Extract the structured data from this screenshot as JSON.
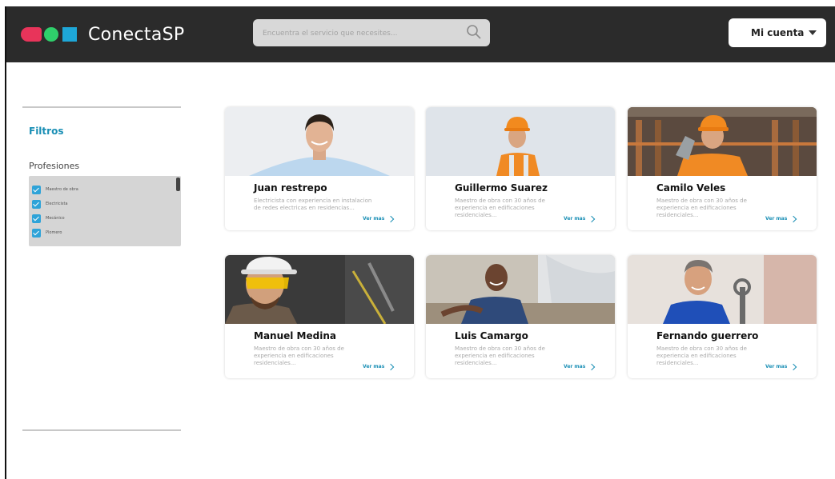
{
  "header": {
    "brand": "ConectaSP",
    "search_placeholder": "Encuentra el servicio que necesites...",
    "account_label": "Mi cuenta"
  },
  "colors": {
    "topbar": "#2b2b2b",
    "accent": "#1a8fb5",
    "logo_red": "#e8345a",
    "logo_green": "#2fd06b",
    "logo_blue": "#1ea7d8"
  },
  "sidebar": {
    "filters_title": "Filtros",
    "professions_title": "Profesiones",
    "professions": [
      "Maestro de obra",
      "Electricista",
      "Mecánico",
      "Plomero"
    ]
  },
  "cards": [
    {
      "name": "Juan restrepo",
      "description": "Electricista con experiencia en instalacion de redes electricas en residencias...",
      "link": "Ver mas"
    },
    {
      "name": "Guillermo Suarez",
      "description": "Maestro de obra con 30 años de experiencia en edificaciones residenciales...",
      "link": "Ver mas"
    },
    {
      "name": "Camilo Veles",
      "description": "Maestro de obra con 30 años de experiencia en edificaciones residenciales...",
      "link": "Ver mas"
    },
    {
      "name": "Manuel Medina",
      "description": "Maestro de obra con 30 años de experiencia en edificaciones residenciales...",
      "link": "Ver mas"
    },
    {
      "name": "Luis Camargo",
      "description": "Maestro de obra con 30 años de experiencia en edificaciones residenciales...",
      "link": "Ver mas"
    },
    {
      "name": "Fernando guerrero",
      "description": "Maestro de obra con 30 años de experiencia en edificaciones residenciales...",
      "link": "Ver mas"
    }
  ]
}
